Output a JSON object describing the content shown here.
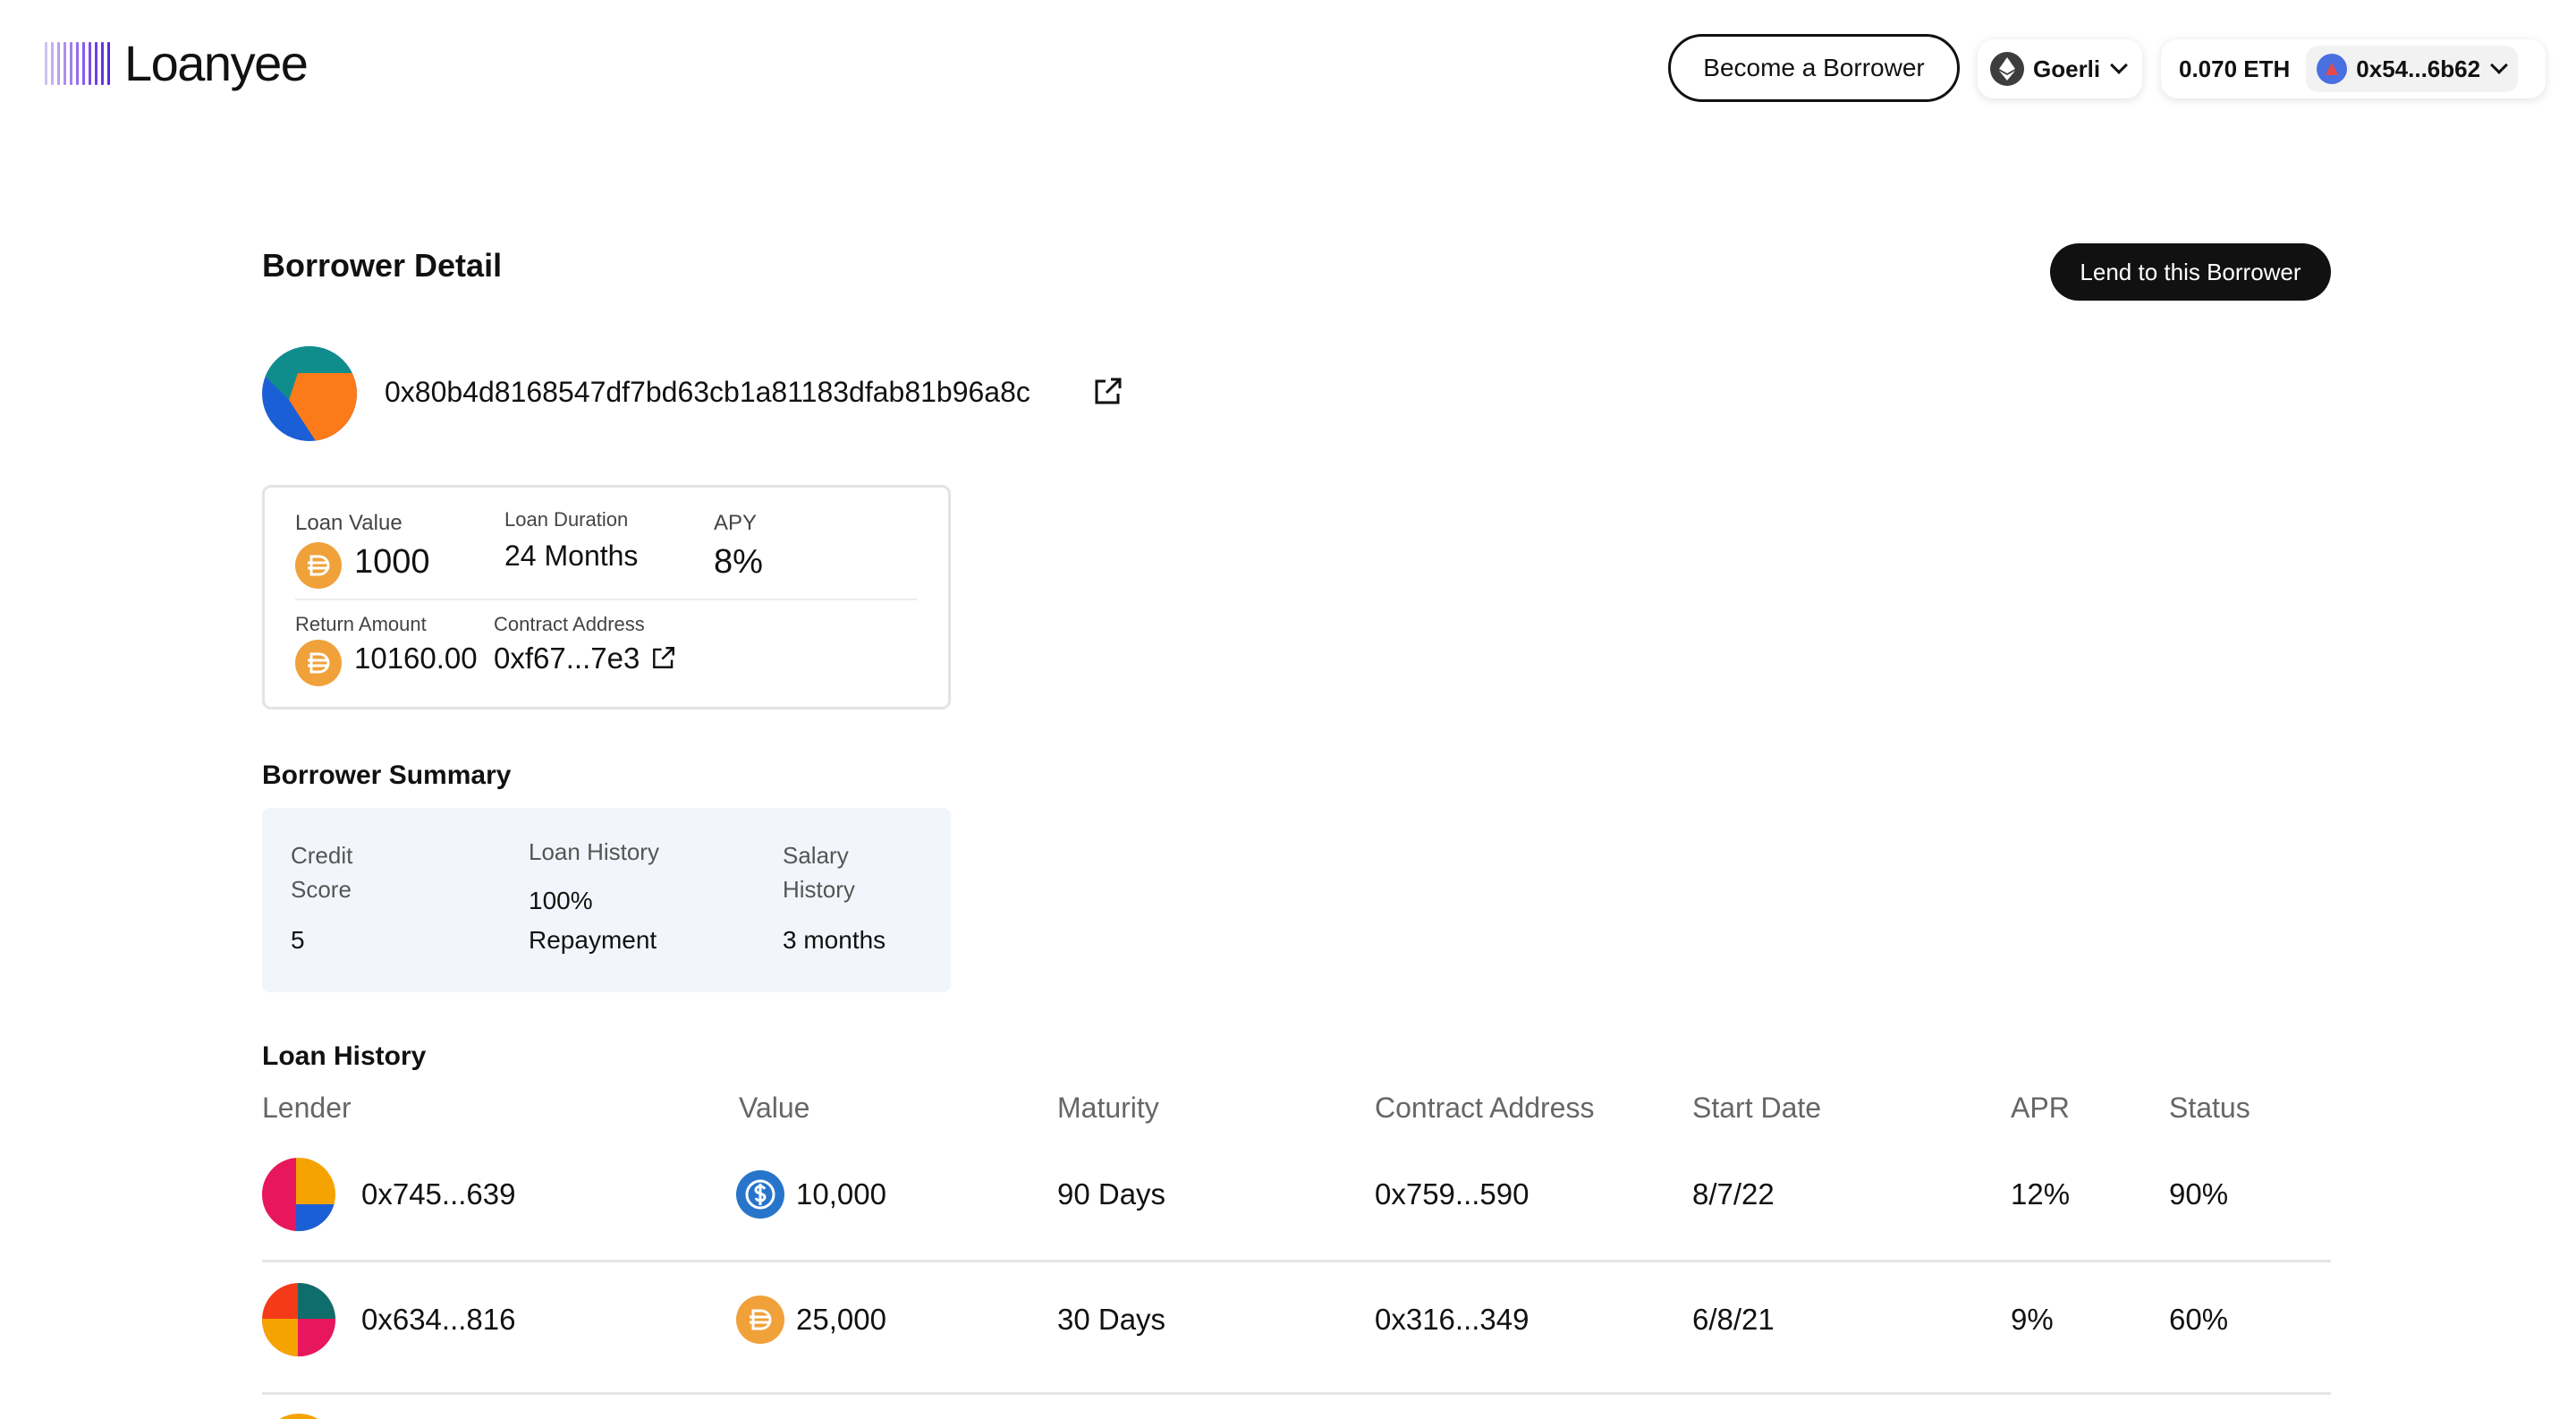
{
  "brand": {
    "name": "Loanyee"
  },
  "header": {
    "become_borrower_label": "Become a Borrower",
    "network": {
      "name": "Goerli",
      "icon": "ethereum-icon"
    },
    "wallet": {
      "balance": "0.070 ETH",
      "address": "0x54...6b62"
    }
  },
  "page": {
    "title": "Borrower Detail",
    "lend_button_label": "Lend to this Borrower",
    "borrower_address": "0x80b4d8168547df7bd63cb1a81183dfab81b96a8c"
  },
  "loan_card": {
    "loan_value_label": "Loan Value",
    "loan_value": "1000",
    "loan_duration_label": "Loan Duration",
    "loan_duration": "24 Months",
    "apy_label": "APY",
    "apy": "8%",
    "return_amount_label": "Return Amount",
    "return_amount": "10160.00",
    "contract_address_label": "Contract Address",
    "contract_address": "0xf67...7e3"
  },
  "summary": {
    "title": "Borrower Summary",
    "credit_score_label_1": "Credit",
    "credit_score_label_2": "Score",
    "credit_score": "5",
    "loan_history_label": "Loan History",
    "loan_history_value_1": "100%",
    "loan_history_value_2": "Repayment",
    "salary_history_label_1": "Salary",
    "salary_history_label_2": "History",
    "salary_history": "3 months"
  },
  "loan_history": {
    "title": "Loan History",
    "columns": [
      "Lender",
      "Value",
      "Maturity",
      "Contract Address",
      "Start Date",
      "APR",
      "Status"
    ],
    "rows": [
      {
        "lender": "0x745...639",
        "value": "10,000",
        "coin": "usdc-icon",
        "maturity": "90 Days",
        "contract": "0x759...590",
        "start": "8/7/22",
        "apr": "12%",
        "status": "90%"
      },
      {
        "lender": "0x634...816",
        "value": "25,000",
        "coin": "dai-icon",
        "maturity": "30 Days",
        "contract": "0x316...349",
        "start": "6/8/21",
        "apr": "9%",
        "status": "60%"
      }
    ]
  },
  "colors": {
    "accent": "#111111",
    "coin_dai": "#f0a13a",
    "coin_usdc": "#2775ca",
    "logo_purple": "#8a3ffc",
    "summary_bg": "#f2f6fc"
  }
}
